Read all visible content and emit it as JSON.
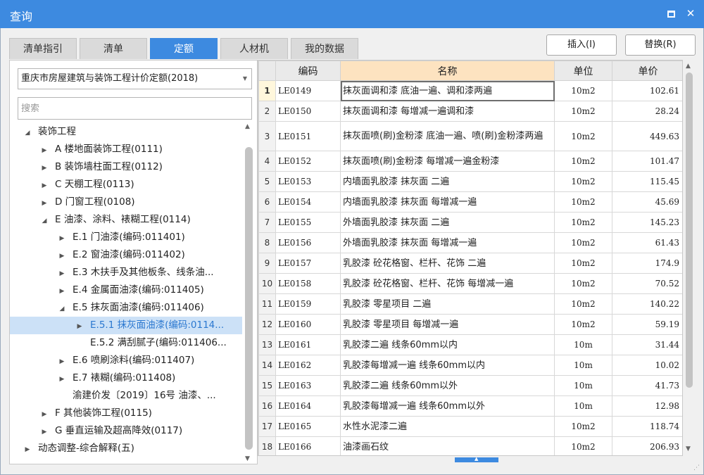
{
  "window": {
    "title": "查询",
    "maximize_label": "maximize",
    "close_glyph": "✕"
  },
  "tabs": [
    {
      "label": "清单指引"
    },
    {
      "label": "清单"
    },
    {
      "label": "定额",
      "active": true
    },
    {
      "label": "人材机"
    },
    {
      "label": "我的数据"
    }
  ],
  "actions": {
    "insert": "插入(I)",
    "replace": "替换(R)"
  },
  "left": {
    "library": "重庆市房屋建筑与装饰工程计价定额(2018)",
    "search_placeholder": "搜索",
    "tree": [
      {
        "label": "装饰工程",
        "arrow": "expanded",
        "level": 1
      },
      {
        "label": "A 楼地面装饰工程(0111)",
        "arrow": "collapsed",
        "level": 2
      },
      {
        "label": "B 装饰墙柱面工程(0112)",
        "arrow": "collapsed",
        "level": 2
      },
      {
        "label": "C 天棚工程(0113)",
        "arrow": "collapsed",
        "level": 2
      },
      {
        "label": "D 门窗工程(0108)",
        "arrow": "collapsed",
        "level": 2
      },
      {
        "label": "E 油漆、涂料、裱糊工程(0114)",
        "arrow": "expanded",
        "level": 2
      },
      {
        "label": "E.1 门油漆(编码:011401)",
        "arrow": "collapsed",
        "level": 3
      },
      {
        "label": "E.2 窗油漆(编码:011402)",
        "arrow": "collapsed",
        "level": 3
      },
      {
        "label": "E.3 木扶手及其他板条、线条油...",
        "arrow": "collapsed",
        "level": 3
      },
      {
        "label": "E.4 金属面油漆(编码:011405)",
        "arrow": "collapsed",
        "level": 3
      },
      {
        "label": "E.5 抹灰面油漆(编码:011406)",
        "arrow": "expanded",
        "level": 3
      },
      {
        "label": "E.5.1 抹灰面油漆(编码:0114...",
        "arrow": "collapsed",
        "level": 4,
        "selected": true
      },
      {
        "label": "E.5.2 满刮腻子(编码:011406...",
        "arrow": "none",
        "level": 4
      },
      {
        "label": "E.6 喷刷涂料(编码:011407)",
        "arrow": "collapsed",
        "level": 3
      },
      {
        "label": "E.7 裱糊(编码:011408)",
        "arrow": "collapsed",
        "level": 3
      },
      {
        "label": "渝建价发〔2019〕16号 油漆、...",
        "arrow": "none",
        "level": 3
      },
      {
        "label": "F 其他装饰工程(0115)",
        "arrow": "collapsed",
        "level": 2
      },
      {
        "label": "G 垂直运输及超高降效(0117)",
        "arrow": "collapsed",
        "level": 2
      },
      {
        "label": "动态调整-综合解释(五)",
        "arrow": "collapsed",
        "level": 1
      }
    ]
  },
  "grid": {
    "headers": {
      "code": "编码",
      "name": "名称",
      "unit": "单位",
      "price": "单价"
    },
    "rows": [
      {
        "idx": "1",
        "code": "LE0149",
        "name": "抹灰面调和漆 底油一遍、调和漆两遍",
        "unit": "10m2",
        "price": "102.61",
        "current": true
      },
      {
        "idx": "2",
        "code": "LE0150",
        "name": "抹灰面调和漆 每增减一遍调和漆",
        "unit": "10m2",
        "price": "28.24"
      },
      {
        "idx": "3",
        "code": "LE0151",
        "name": "抹灰面喷(刷)金粉漆 底油一遍、喷(刷)金粉漆两遍",
        "unit": "10m2",
        "price": "449.63",
        "tall": true
      },
      {
        "idx": "4",
        "code": "LE0152",
        "name": "抹灰面喷(刷)金粉漆 每增减一遍金粉漆",
        "unit": "10m2",
        "price": "101.47"
      },
      {
        "idx": "5",
        "code": "LE0153",
        "name": "内墙面乳胶漆 抹灰面 二遍",
        "unit": "10m2",
        "price": "115.45"
      },
      {
        "idx": "6",
        "code": "LE0154",
        "name": "内墙面乳胶漆 抹灰面 每增减一遍",
        "unit": "10m2",
        "price": "45.69"
      },
      {
        "idx": "7",
        "code": "LE0155",
        "name": "外墙面乳胶漆 抹灰面 二遍",
        "unit": "10m2",
        "price": "145.23"
      },
      {
        "idx": "8",
        "code": "LE0156",
        "name": "外墙面乳胶漆 抹灰面 每增减一遍",
        "unit": "10m2",
        "price": "61.43"
      },
      {
        "idx": "9",
        "code": "LE0157",
        "name": "乳胶漆 砼花格窗、栏杆、花饰 二遍",
        "unit": "10m2",
        "price": "174.9"
      },
      {
        "idx": "10",
        "code": "LE0158",
        "name": "乳胶漆 砼花格窗、栏杆、花饰 每增减一遍",
        "unit": "10m2",
        "price": "70.52"
      },
      {
        "idx": "11",
        "code": "LE0159",
        "name": "乳胶漆 零星项目 二遍",
        "unit": "10m2",
        "price": "140.22"
      },
      {
        "idx": "12",
        "code": "LE0160",
        "name": "乳胶漆 零星项目 每增减一遍",
        "unit": "10m2",
        "price": "59.19"
      },
      {
        "idx": "13",
        "code": "LE0161",
        "name": "乳胶漆二遍 线条60mm以内",
        "unit": "10m",
        "price": "31.44"
      },
      {
        "idx": "14",
        "code": "LE0162",
        "name": "乳胶漆每增减一遍 线条60mm以内",
        "unit": "10m",
        "price": "10.02"
      },
      {
        "idx": "15",
        "code": "LE0163",
        "name": "乳胶漆二遍 线条60mm以外",
        "unit": "10m",
        "price": "41.73"
      },
      {
        "idx": "16",
        "code": "LE0164",
        "name": "乳胶漆每增减一遍 线条60mm以外",
        "unit": "10m",
        "price": "12.98"
      },
      {
        "idx": "17",
        "code": "LE0165",
        "name": "水性水泥漆二遍",
        "unit": "10m2",
        "price": "118.74"
      },
      {
        "idx": "18",
        "code": "LE0166",
        "name": "油漆画石纹",
        "unit": "10m2",
        "price": "206.93"
      }
    ]
  },
  "colors": {
    "accent": "#3d8ae0",
    "header_name_bg": "#fde3c0",
    "selected_tree_bg": "#cce1f7"
  }
}
